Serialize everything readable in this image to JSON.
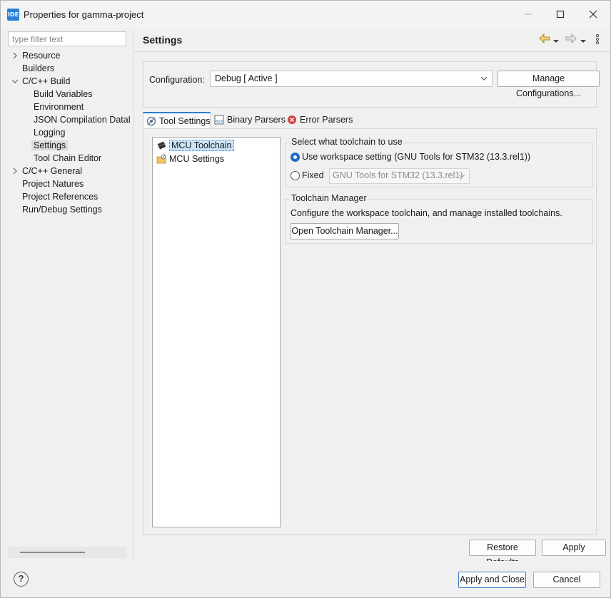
{
  "window": {
    "title": "Properties for gamma-project",
    "app_icon_label": "IDE"
  },
  "left": {
    "filter_placeholder": "type filter text",
    "tree": [
      {
        "label": "Resource",
        "expandable": true
      },
      {
        "label": "Builders"
      },
      {
        "label": "C/C++ Build",
        "expanded": true
      },
      {
        "label": "Build Variables"
      },
      {
        "label": "Environment"
      },
      {
        "label": "JSON Compilation Datab"
      },
      {
        "label": "Logging"
      },
      {
        "label": "Settings",
        "selected": true
      },
      {
        "label": "Tool Chain Editor"
      },
      {
        "label": "C/C++ General",
        "expandable": true
      },
      {
        "label": "Project Natures"
      },
      {
        "label": "Project References"
      },
      {
        "label": "Run/Debug Settings"
      }
    ]
  },
  "page": {
    "title": "Settings"
  },
  "config": {
    "label": "Configuration:",
    "value": "Debug  [ Active ]",
    "manage_button": "Manage Configurations..."
  },
  "tabs": [
    {
      "label": "Tool Settings",
      "active": true
    },
    {
      "label": "Binary Parsers"
    },
    {
      "label": "Error Parsers"
    }
  ],
  "tool_tree": [
    {
      "label": "MCU Toolchain",
      "selected": true
    },
    {
      "label": "MCU Settings"
    }
  ],
  "toolchain_select": {
    "legend": "Select what toolchain to use",
    "workspace_option": "Use workspace setting (GNU Tools for STM32 (13.3.rel1))",
    "fixed_option": "Fixed",
    "fixed_value": "GNU Tools for STM32 (13.3.rel1)"
  },
  "toolchain_manager": {
    "legend": "Toolchain Manager",
    "description": "Configure the workspace toolchain, and manage installed toolchains.",
    "button": "Open Toolchain Manager..."
  },
  "buttons": {
    "restore_defaults": "Restore Defaults",
    "apply": "Apply",
    "apply_and_close": "Apply and Close",
    "cancel": "Cancel"
  },
  "colors": {
    "accent": "#2a7fd6",
    "selection": "#cce4f7"
  }
}
